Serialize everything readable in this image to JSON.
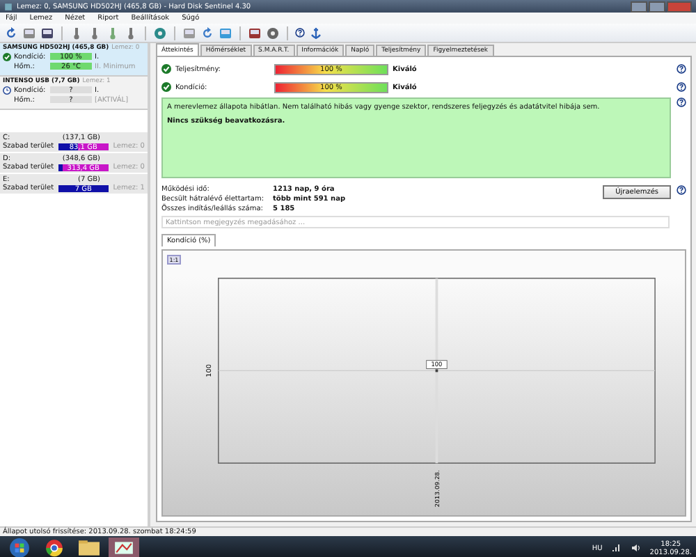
{
  "window": {
    "title": "Lemez: 0, SAMSUNG HD502HJ (465,8 GB) - Hard Disk Sentinel 4.30"
  },
  "menu": [
    "Fájl",
    "Lemez",
    "Nézet",
    "Riport",
    "Beállítások",
    "Súgó"
  ],
  "disks": [
    {
      "name": "SAMSUNG HD502HJ (465,8 GB)",
      "disk_label": "Lemez: 0",
      "selected": true,
      "kind": "ok",
      "condition_label": "Kondíció:",
      "condition": {
        "reading": "100 %",
        "level": 1
      },
      "condition_note": "I.",
      "temp_label": "Hőm.:",
      "temp": {
        "reading": "26 °C",
        "level": 1
      },
      "temp_note": "II. Minimum"
    },
    {
      "name": "INTENSO USB (7,7 GB)",
      "disk_label": "Lemez: 1",
      "selected": false,
      "kind": "unknown",
      "condition_label": "Kondíció:",
      "condition": {
        "reading": "?",
        "level": 0
      },
      "condition_note": "I.",
      "temp_label": "Hőm.:",
      "temp": {
        "reading": "?",
        "level": 0
      },
      "temp_note": "[AKTIVÁL]"
    }
  ],
  "volumes": [
    {
      "letter": "C:",
      "size": "(137,1 GB)",
      "free_label": "Szabad terület",
      "free": "83,1 GB",
      "level": 0.4,
      "disk": "Lemez: 0"
    },
    {
      "letter": "D:",
      "size": "(348,6 GB)",
      "free_label": "Szabad terület",
      "free": "313,4 GB",
      "level": 0.1,
      "disk": "Lemez: 0"
    },
    {
      "letter": "E:",
      "size": "(7 GB)",
      "free_label": "Szabad terület",
      "free": "7 GB",
      "level": 1,
      "disk": "Lemez: 1"
    }
  ],
  "tabs": [
    {
      "label": "Áttekintés",
      "selected": true
    },
    {
      "label": "Hőmérséklet",
      "selected": false
    },
    {
      "label": "S.M.A.R.T.",
      "selected": false
    },
    {
      "label": "Információk",
      "selected": false
    },
    {
      "label": "Napló",
      "selected": false
    },
    {
      "label": "Teljesítmény",
      "selected": false
    },
    {
      "label": "Figyelmeztetések",
      "selected": false
    }
  ],
  "ratings": [
    {
      "label": "Teljesítmény:",
      "reading": "100 %",
      "level": 1,
      "verdict": "Kiváló"
    },
    {
      "label": "Kondíció:",
      "reading": "100 %",
      "level": 1,
      "verdict": "Kiváló"
    }
  ],
  "summary": {
    "text": "A merevlemez állapota hibátlan. Nem található hibás vagy gyenge szektor, rendszeres feljegyzés és adatátvitel hibája sem.",
    "advice": "Nincs szükség beavatkozásra."
  },
  "stats": [
    {
      "label": "Működési idő:",
      "value": "1213 nap, 9 óra"
    },
    {
      "label": "Becsült hátralévő élettartam:",
      "value": "több mint 591 nap"
    },
    {
      "label": "Összes indítás/leállás száma:",
      "value": "5 185"
    }
  ],
  "recheck_button": "Újraelemzés",
  "comment": {
    "placeholder": "Kattintson megjegyzés megadásához ..."
  },
  "chart": {
    "tab": "Kondíció (%)",
    "zoom": "1:1",
    "axis_value": "100",
    "point_label": "100",
    "date_label": "2013.09.28."
  },
  "status_bar": "Állapot utolsó frissítése: 2013.09.28. szombat 18:24:59",
  "taskbar": {
    "language": "HU",
    "time": "18:25",
    "date": "2013.09.28."
  }
}
